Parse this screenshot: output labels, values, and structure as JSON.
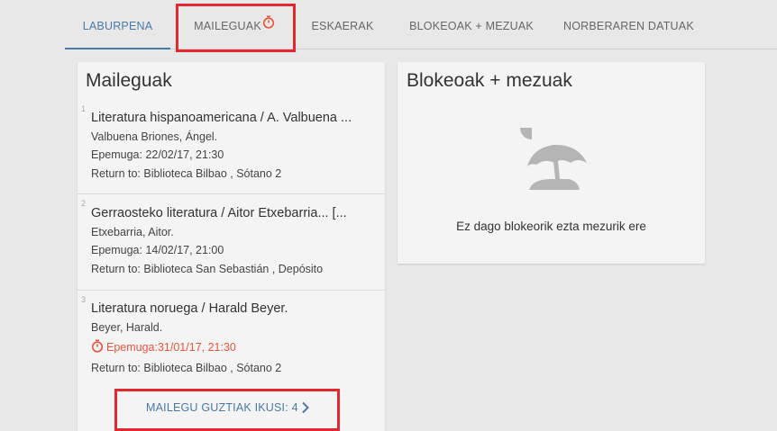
{
  "tabs": [
    {
      "label": "LABURPENA",
      "active": true
    },
    {
      "label": "MAILEGUAK",
      "icon": "stopwatch-icon",
      "active": false
    },
    {
      "label": "ESKAERAK",
      "active": false
    },
    {
      "label": "BLOKEOAK + MEZUAK",
      "active": false
    },
    {
      "label": "NORBERAREN DATUAK",
      "active": false
    }
  ],
  "loans_panel": {
    "title": "Maileguak",
    "items": [
      {
        "num": "1",
        "title": "Literatura hispanoamericana / A. Valbuena ...",
        "author": "Valbuena Briones, Ángel.",
        "due": "Epemuga: 22/02/17, 21:30",
        "return_to": "Return to: Biblioteca Bilbao , Sótano 2"
      },
      {
        "num": "2",
        "title": "Gerraosteko literatura / Aitor Etxebarria... [...",
        "author": "Etxebarria, Aitor.",
        "due": "Epemuga: 14/02/17, 21:00",
        "return_to": "Return to: Biblioteca San Sebastián , Depósito"
      },
      {
        "num": "3",
        "title": "Literatura noruega / Harald Beyer.",
        "author": "Beyer, Harald.",
        "due": "Epemuga:31/01/17, 21:30",
        "due_icon": "stopwatch-icon",
        "overdue": true,
        "return_to": "Return to: Biblioteca Bilbao , Sótano 2"
      }
    ],
    "see_all": "MAILEGU GUZTIAK IKUSI: 4",
    "see_all_icon": "chevron-right-icon"
  },
  "blocks_panel": {
    "title": "Blokeoak + mezuak",
    "illustration": "beach-umbrella-icon",
    "empty_message": "Ez dago blokeorik ezta mezurik ere"
  },
  "colors": {
    "accent": "#4a7aa8",
    "overdue": "#e8553e",
    "highlight": "#e0282e",
    "background": "#e8e8e8",
    "panel": "#f4f4f4"
  }
}
